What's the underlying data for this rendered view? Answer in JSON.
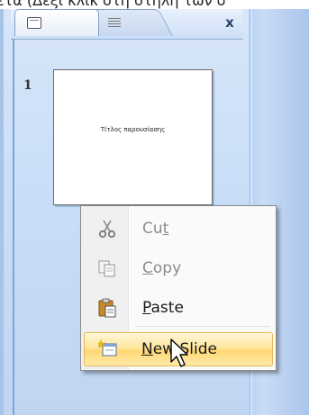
{
  "caption": "ετα (Δεξί κλικ στη στήλη των δ",
  "tabs": {
    "close_label": "x",
    "slides_tab_icon": "slides-icon",
    "outline_tab_icon": "outline-icon"
  },
  "slides": [
    {
      "number": "1",
      "title": "Τίτλος παρουσίασης"
    }
  ],
  "context_menu": {
    "items": [
      {
        "pre": "Cu",
        "key": "t",
        "post": "",
        "enabled": false,
        "icon": "scissors-icon"
      },
      {
        "pre": "",
        "key": "C",
        "post": "opy",
        "enabled": false,
        "icon": "copy-icon"
      },
      {
        "pre": "",
        "key": "P",
        "post": "aste",
        "enabled": true,
        "icon": "paste-icon"
      },
      {
        "pre": "",
        "key": "N",
        "post": "ew Slide",
        "enabled": true,
        "highlighted": true,
        "icon": "new-slide-icon"
      }
    ]
  },
  "colors": {
    "highlight": "#ffd874",
    "pane_bg": "#cadff7",
    "frame": "#b9d3f2"
  }
}
